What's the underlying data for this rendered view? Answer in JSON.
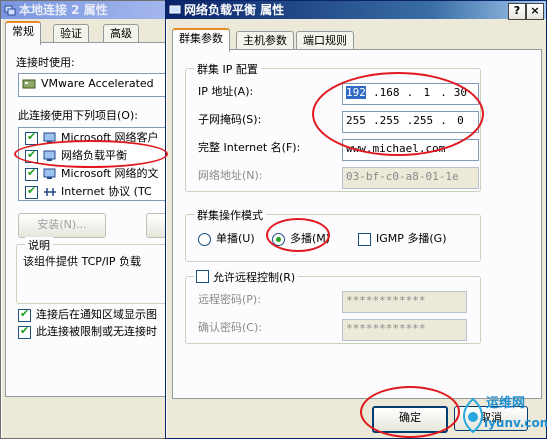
{
  "back_window": {
    "title": "本地连接 2 属性",
    "tabs": [
      "常规",
      "验证",
      "高级"
    ],
    "connect_using_label": "连接时使用:",
    "adapter_name": "VMware Accelerated",
    "items_label": "此连接使用下列项目(O):",
    "items": [
      {
        "label": "Microsoft 网络客户",
        "checked": true
      },
      {
        "label": "网络负载平衡",
        "checked": true
      },
      {
        "label": "Microsoft 网络的文",
        "checked": true
      },
      {
        "label": "Internet 协议 (TC",
        "checked": true
      }
    ],
    "install_button": "安装(N)...",
    "description_title": "说明",
    "description_text": "该组件提供 TCP/IP 负载",
    "bottom_checks": [
      {
        "label": "连接后在通知区域显示图",
        "checked": true
      },
      {
        "label": "此连接被限制或无连接时",
        "checked": true
      }
    ]
  },
  "front_window": {
    "title": "网络负载平衡 属性",
    "title_buttons": {
      "help": "?",
      "close": "×"
    },
    "tabs": [
      "群集参数",
      "主机参数",
      "端口规则"
    ],
    "cluster_ip_group": "群集 IP 配置",
    "ip_label": "IP 地址(A):",
    "ip_segments": [
      "192",
      "168",
      "1",
      "30"
    ],
    "mask_label": "子网掩码(S):",
    "mask_segments": [
      "255",
      "255",
      "255",
      "0"
    ],
    "fqdn_label": "完整 Internet 名(F):",
    "fqdn_value": "www.michael.com",
    "netaddr_label": "网络地址(N):",
    "netaddr_value": "03-bf-c0-a8-01-1e",
    "mode_group": "群集操作模式",
    "mode_unicast": "单播(U)",
    "mode_multicast": "多播(M)",
    "mode_igmp": "IGMP 多播(G)",
    "selected_mode": "multicast",
    "remote_control_label": "允许远程控制(R)",
    "remote_control_checked": false,
    "remote_pw_label": "远程密码(P):",
    "remote_pw_value": "************",
    "confirm_pw_label": "确认密码(C):",
    "confirm_pw_value": "************",
    "ok_button": "确定",
    "cancel_button": "取消"
  },
  "watermark": {
    "brand": "运维网",
    "url": "iyunv.com"
  },
  "colors": {
    "annotation_red": "#e0191e",
    "selection_blue": "#316ac5"
  }
}
